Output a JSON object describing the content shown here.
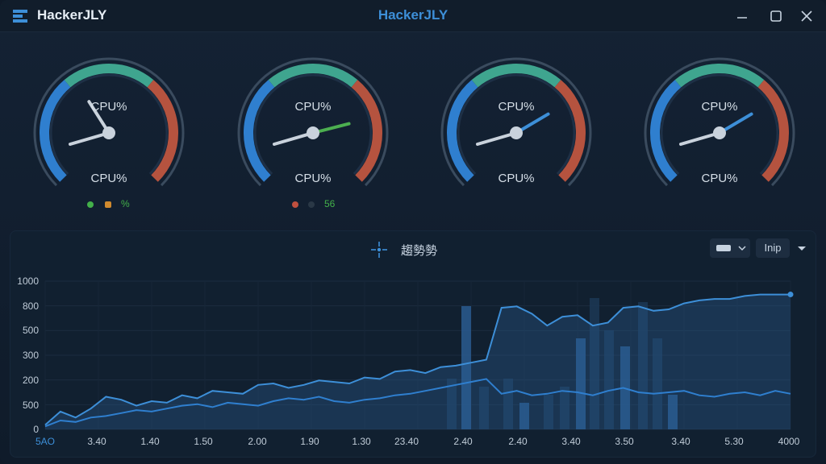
{
  "titlebar": {
    "app_name": "HackerJLY",
    "center_title": "HackerJLY",
    "icons": [
      "logo-icon",
      "minimize-icon",
      "maximize-icon",
      "close-icon"
    ]
  },
  "gauges": [
    {
      "top_label": "CPU%",
      "bottom_label": "CPU%",
      "value": 0.38,
      "needle_color": "#c9d2dc"
    },
    {
      "top_label": "CPU%",
      "bottom_label": "CPU%",
      "value": 0.78,
      "needle_color": "#4caf50"
    },
    {
      "top_label": "CPU%",
      "bottom_label": "CPU%",
      "value": 0.72,
      "needle_color": "#3d8fd8"
    },
    {
      "top_label": "CPU%",
      "bottom_label": "CPU%",
      "value": 0.72,
      "needle_color": "#3d8fd8"
    }
  ],
  "legend1": {
    "text": "%",
    "dot_color": "#43b04a",
    "square_color": "#d08a2e",
    "text_color": "#43b04a"
  },
  "legend2": {
    "text": "56",
    "dot_color": "#c0503f",
    "dot2_color": "#2a3846",
    "text_color": "#43b04a"
  },
  "panel": {
    "title": "趨勢勢",
    "dropdown_label": "Inip"
  },
  "chart_data": {
    "type": "line",
    "y_ticks": [
      "1000",
      "800",
      "500",
      "300",
      "200",
      "500",
      "0"
    ],
    "x_ticks": [
      "5AO",
      "3.40",
      "1.40",
      "1.50",
      "2.00",
      "1.90",
      "1.30",
      "23.40",
      "2.40",
      "2.40",
      "3.40",
      "3.50",
      "3.40",
      "5.30",
      "4000"
    ],
    "ylim": [
      0,
      1000
    ],
    "series": [
      {
        "values": [
          30,
          120,
          80,
          140,
          220,
          200,
          160,
          190,
          180,
          230,
          210,
          260,
          250,
          240,
          300,
          310,
          280,
          300,
          330,
          320,
          310,
          350,
          340,
          390,
          400,
          380,
          420,
          430,
          450,
          470,
          820,
          830,
          780,
          700,
          760,
          770,
          700,
          720,
          820,
          830,
          800,
          810,
          850,
          870,
          880,
          880,
          900,
          910,
          910,
          910
        ]
      },
      {
        "values": [
          20,
          60,
          50,
          80,
          90,
          110,
          130,
          120,
          140,
          160,
          170,
          150,
          180,
          170,
          160,
          190,
          210,
          200,
          220,
          190,
          180,
          200,
          210,
          230,
          240,
          260,
          280,
          300,
          320,
          340,
          240,
          260,
          230,
          240,
          260,
          250,
          230,
          260,
          280,
          250,
          240,
          250,
          260,
          230,
          220,
          240,
          250,
          230,
          260,
          240
        ]
      }
    ]
  }
}
